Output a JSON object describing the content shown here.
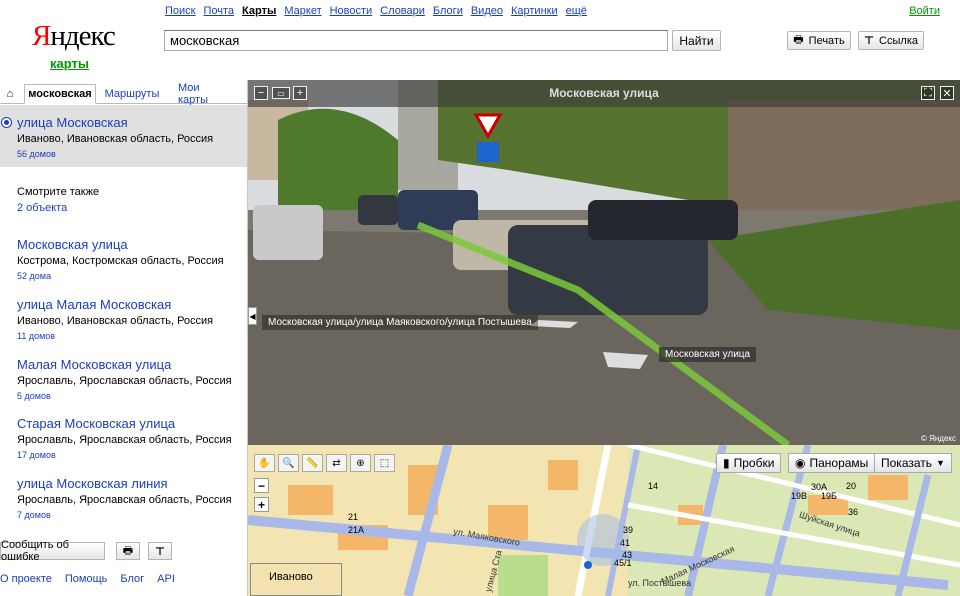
{
  "header": {
    "logo": "Яндекс",
    "logo_sub": "карты",
    "services": [
      "Поиск",
      "Почта",
      "Карты",
      "Маркет",
      "Новости",
      "Словари",
      "Блоги",
      "Видео",
      "Картинки",
      "ещё"
    ],
    "active_service": "Карты",
    "login": "Войти",
    "search_value": "московская",
    "search_button": "Найти",
    "print_button": "Печать",
    "link_button": "Ссылка"
  },
  "sidebar": {
    "tabs": [
      "московская",
      "Маршруты",
      "Мои карты"
    ],
    "selected": {
      "title": "улица Московская",
      "address": "Иваново, Ивановская область, Россия",
      "count": "56 домов"
    },
    "see_also": {
      "label": "Смотрите также",
      "count": "2 объекта"
    },
    "results": [
      {
        "title": "Московская улица",
        "address": "Кострома, Костромская область, Россия",
        "count": "52 дома"
      },
      {
        "title": "улица Малая Московская",
        "address": "Иваново, Ивановская область, Россия",
        "count": "11 домов"
      },
      {
        "title": "Малая Московская улица",
        "address": "Ярославль, Ярославская область, Россия",
        "count": "5 домов"
      },
      {
        "title": "Старая Московская улица",
        "address": "Ярославль, Ярославская область, Россия",
        "count": "17 домов"
      },
      {
        "title": "улица Московская линия",
        "address": "Ярославль, Ярославская область, Россия",
        "count": "7 домов"
      }
    ],
    "report_button": "Сообщить об ошибке",
    "footer": [
      "О проекте",
      "Помощь",
      "Блог",
      "API"
    ]
  },
  "panorama": {
    "title": "Московская улица",
    "label_1": "Московская улица/улица Маяковского/улица Постышева",
    "label_2": "Московская улица",
    "copyright": "© Яндекс"
  },
  "map": {
    "traffic": "Пробки",
    "panoramas": "Панорамы",
    "show": "Показать",
    "mini_label": "Иваново",
    "street_labels": [
      "ул. Маяковского",
      "Малая Московская",
      "Шуйская улица",
      "ул. Постышева",
      "улица Ста"
    ],
    "house_numbers": [
      "21",
      "21А",
      "39",
      "41",
      "43",
      "45/1",
      "14",
      "30А",
      "19В",
      "19Б",
      "20",
      "36"
    ]
  },
  "colors": {
    "link": "#1a3dc1",
    "brand_red": "#ff0000",
    "green": "#009900",
    "map_road": "#a8b8e8"
  }
}
